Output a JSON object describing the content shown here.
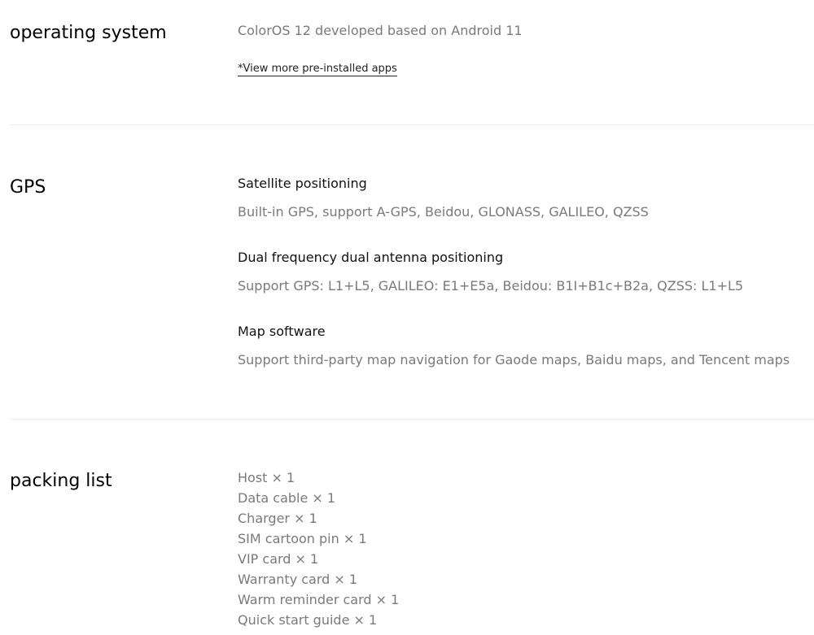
{
  "os": {
    "title": "operating system",
    "value": "ColorOS 12 developed based on Android 11",
    "link_label": "*View more pre-installed apps"
  },
  "gps": {
    "title": "GPS",
    "items": [
      {
        "heading": "Satellite positioning",
        "value": "Built-in GPS, support A-GPS, Beidou, GLONASS, GALILEO, QZSS"
      },
      {
        "heading": "Dual frequency dual antenna positioning",
        "value": "Support GPS: L1+L5, GALILEO: E1+E5a, Beidou: B1I+B1c+B2a, QZSS: L1+L5"
      },
      {
        "heading": "Map software",
        "value": "Support third-party map navigation for Gaode maps, Baidu maps, and Tencent maps"
      }
    ]
  },
  "packing": {
    "title": "packing list",
    "items": [
      "Host × 1",
      "Data cable × 1",
      "Charger × 1",
      "SIM cartoon pin × 1",
      "VIP card × 1",
      "Warranty card × 1",
      "Warm reminder card × 1",
      "Quick start guide × 1"
    ]
  }
}
